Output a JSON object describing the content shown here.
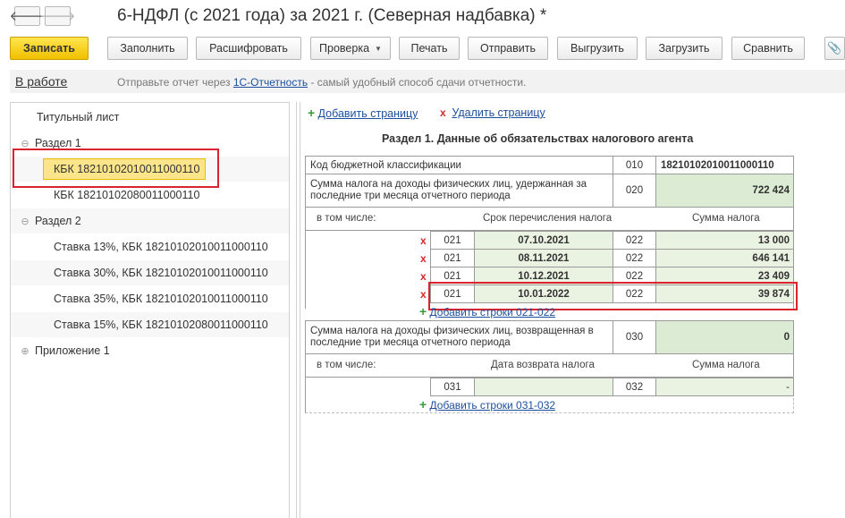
{
  "window": {
    "title": "6-НДФЛ (с 2021 года) за 2021 г. (Северная надбавка) *",
    "back_glyph": "🡐",
    "forward_glyph": "🡒"
  },
  "toolbar": {
    "save": "Записать",
    "fill": "Заполнить",
    "decode": "Расшифровать",
    "check": "Проверка",
    "print": "Печать",
    "send": "Отправить",
    "export": "Выгрузить",
    "import": "Загрузить",
    "compare": "Сравнить",
    "attach_glyph": "📎"
  },
  "status": {
    "state": "В работе",
    "hint_prefix": "Отправьте отчет через ",
    "hint_link": "1С-Отчетность",
    "hint_suffix": " - самый удобный способ сдачи отчетности."
  },
  "tree": {
    "title_page": "Титульный лист",
    "section1": "Раздел 1",
    "section1_items": [
      "КБК 18210102010011000110",
      "КБК 18210102080011000110"
    ],
    "section2": "Раздел 2",
    "section2_items": [
      "Ставка 13%, КБК 18210102010011000110",
      "Ставка 30%, КБК 18210102010011000110",
      "Ставка 35%, КБК 18210102010011000110",
      "Ставка 15%, КБК 18210102080011000110"
    ],
    "appendix1": "Приложение 1",
    "minus_glyph": "⊖",
    "plus_glyph": "⊕"
  },
  "form": {
    "add_page": "Добавить страницу",
    "delete_page": "Удалить страницу",
    "section_title": "Раздел 1. Данные об обязательствах налогового агента",
    "kbk_label": "Код бюджетной классификации",
    "kbk_code": "010",
    "kbk_value": "18210102010011000110",
    "withheld_label": "Сумма налога на доходы физических лиц, удержанная за последние три месяца отчетного периода",
    "withheld_code": "020",
    "withheld_value": "722 424",
    "including": "в том числе:",
    "transfer_date_header": "Срок перечисления налога",
    "tax_sum_header": "Сумма налога",
    "rows": [
      {
        "code1": "021",
        "date": "07.10.2021",
        "code2": "022",
        "sum": "13 000"
      },
      {
        "code1": "021",
        "date": "08.11.2021",
        "code2": "022",
        "sum": "646 141"
      },
      {
        "code1": "021",
        "date": "10.12.2021",
        "code2": "022",
        "sum": "23 409"
      },
      {
        "code1": "021",
        "date": "10.01.2022",
        "code2": "022",
        "sum": "39 874"
      }
    ],
    "add_rows_021": "Добавить строки 021-022",
    "returned_label": "Сумма налога на доходы физических лиц, возвращенная в последние три месяца отчетного периода",
    "returned_code": "030",
    "returned_value": "0",
    "return_date_header": "Дата возврата налога",
    "return_row": {
      "code1": "031",
      "date": "",
      "code2": "032",
      "sum": "-"
    },
    "add_rows_031": "Добавить строки 031-032",
    "x_glyph": "x",
    "plus_glyph": "+"
  }
}
